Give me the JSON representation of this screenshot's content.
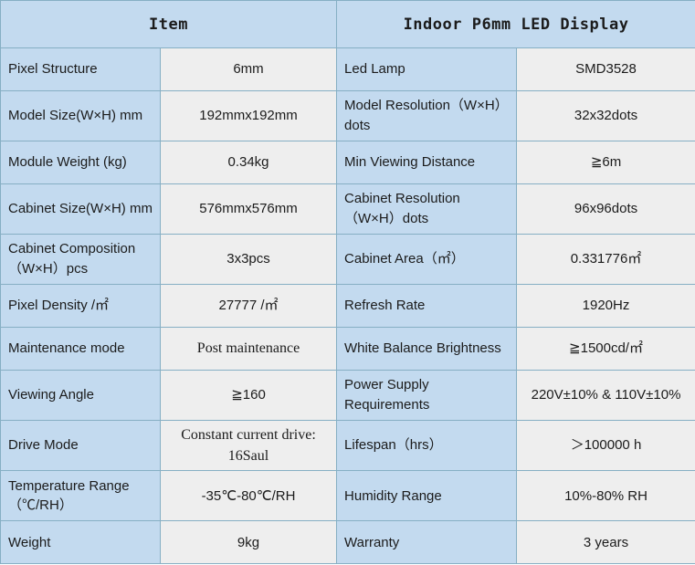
{
  "table": {
    "header": {
      "col_item": "Item",
      "col_product": "Indoor P6mm LED Display"
    },
    "rows": [
      {
        "label_a": "Pixel Structure",
        "value_a": "6mm",
        "label_b": "Led Lamp",
        "value_b": "SMD3528",
        "tall": false,
        "serif_a": false,
        "serif_b": false
      },
      {
        "label_a": "Model Size(W×H) mm",
        "value_a": "192mmx192mm",
        "label_b": "Model  Resolution（W×H）dots",
        "value_b": "32x32dots",
        "tall": true,
        "serif_a": false,
        "serif_b": false
      },
      {
        "label_a": "Module Weight (kg)",
        "value_a": "0.34kg",
        "label_b": "Min Viewing Distance",
        "value_b": "≧6m",
        "tall": false,
        "serif_a": false,
        "serif_b": false
      },
      {
        "label_a": "Cabinet  Size(W×H) mm",
        "value_a": "576mmx576mm",
        "label_b": "Cabinet  Resolution（W×H）dots",
        "value_b": "96x96dots",
        "tall": true,
        "serif_a": false,
        "serif_b": false
      },
      {
        "label_a": "Cabinet  Composition（W×H）pcs",
        "value_a": "3x3pcs",
        "label_b": "Cabinet  Area（㎡）",
        "value_b": "0.331776㎡",
        "tall": true,
        "serif_a": false,
        "serif_b": false
      },
      {
        "label_a": "Pixel Density /㎡",
        "value_a": "27777 /㎡",
        "label_b": "Refresh Rate",
        "value_b": "1920Hz",
        "tall": false,
        "serif_a": false,
        "serif_b": false
      },
      {
        "label_a": "Maintenance mode",
        "value_a": "Post maintenance",
        "label_b": "White Balance Brightness",
        "value_b": "≧1500cd/㎡",
        "tall": false,
        "serif_a": true,
        "serif_b": false
      },
      {
        "label_a": "Viewing Angle",
        "value_a": "≧160",
        "label_b": "Power Supply Requirements",
        "value_b": "220V±10% & 110V±10%",
        "tall": true,
        "serif_a": false,
        "serif_b": false
      },
      {
        "label_a": "Drive Mode",
        "value_a": "Constant current drive: 16Saul",
        "label_b": "Lifespan（hrs）",
        "value_b": "＞100000 h",
        "tall": true,
        "serif_a": true,
        "serif_b": false
      },
      {
        "label_a": "Temperature Range（℃/RH）",
        "value_a": "-35℃-80℃/RH",
        "label_b": "Humidity Range",
        "value_b": "10%-80% RH",
        "tall": true,
        "serif_a": false,
        "serif_b": false
      },
      {
        "label_a": "Weight",
        "value_a": "9kg",
        "label_b": "Warranty",
        "value_b": "3 years",
        "tall": false,
        "serif_a": false,
        "serif_b": false
      }
    ]
  },
  "colors": {
    "label_background": "#c3daef",
    "value_background": "#eeeeee",
    "border": "#86afc4",
    "text": "#1b1b1b"
  }
}
